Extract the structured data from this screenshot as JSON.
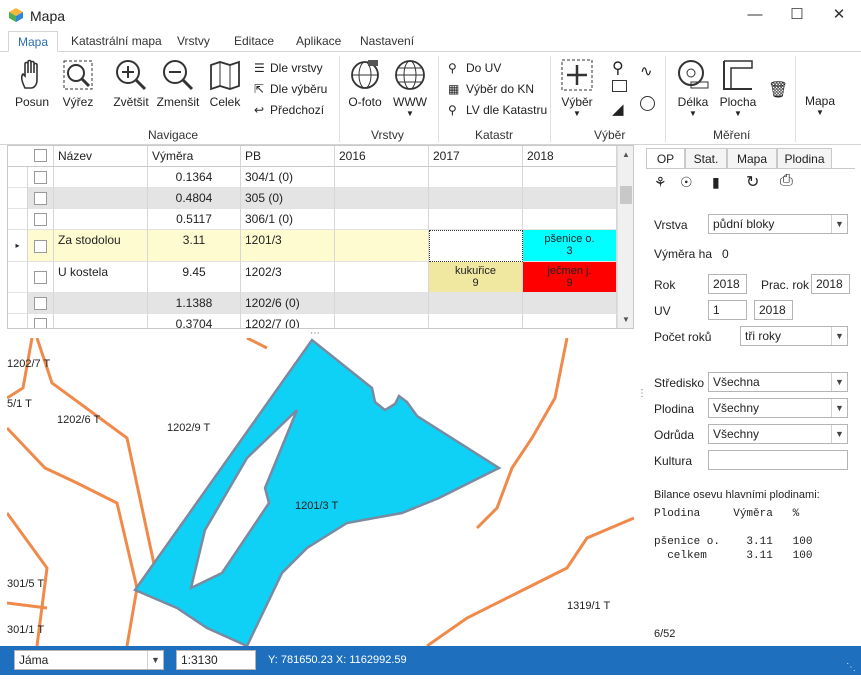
{
  "app": {
    "title": "Mapa"
  },
  "tabs": [
    "Mapa",
    "Katastrální mapa",
    "Vrstvy",
    "Editace",
    "Aplikace",
    "Nastavení"
  ],
  "ribbon": {
    "posun": "Posun",
    "vyrez": "Výřez",
    "zvetsit": "Zvětšit",
    "zmensit": "Zmenšit",
    "celek": "Celek",
    "dle_vrstvy": "Dle vrstvy",
    "dle_vyberu": "Dle výběru",
    "predchozi": "Předchozí",
    "ofoto": "O-foto",
    "www": "WWW",
    "do_uv": "Do UV",
    "vyber_kn": "Výběr do KN",
    "lv_katastr": "LV dle Katastru",
    "vyber": "Výběr",
    "delka": "Délka",
    "plocha": "Plocha",
    "mapa": "Mapa",
    "groups": {
      "navigace": "Navigace",
      "vrstvy": "Vrstvy",
      "katastr": "Katastr",
      "vyber": "Výběr",
      "mereni": "Měření"
    }
  },
  "grid": {
    "headers": [
      "Název",
      "Výměra",
      "PB",
      "2016",
      "2017",
      "2018"
    ],
    "rows": [
      {
        "name": "",
        "vymera": "0.1364",
        "pb": "304/1 (0)",
        "y2016": "",
        "y2017": "",
        "y2018": ""
      },
      {
        "name": "",
        "vymera": "0.4804",
        "pb": "305 (0)",
        "y2016": "",
        "y2017": "",
        "y2018": ""
      },
      {
        "name": "",
        "vymera": "0.5117",
        "pb": "306/1 (0)",
        "y2016": "",
        "y2017": "",
        "y2018": ""
      },
      {
        "name": "Za stodolou",
        "vymera": "3.11",
        "pb": "1201/3",
        "y2016": "",
        "y2017": "",
        "y2018": "pšenice o.\n3"
      },
      {
        "name": "U kostela",
        "vymera": "9.45",
        "pb": "1202/3",
        "y2016": "",
        "y2017": "kukuřice\n9",
        "y2018": "ječmen j.\n9"
      },
      {
        "name": "",
        "vymera": "1.1388",
        "pb": "1202/6 (0)",
        "y2016": "",
        "y2017": "",
        "y2018": ""
      },
      {
        "name": "",
        "vymera": "0.3704",
        "pb": "1202/7 (0)",
        "y2016": "",
        "y2017": "",
        "y2018": ""
      }
    ]
  },
  "map": {
    "labels": {
      "l1": "1202/7 T",
      "l2": "5/1 T",
      "l3": "1202/6 T",
      "l4": "1202/9 T",
      "l5": "1201/3 T",
      "l6": "301/5 T",
      "l7": "301/1 T",
      "l8": "1319/1 T"
    }
  },
  "side": {
    "tabs": [
      "OP",
      "Stat.",
      "Mapa",
      "Plodina"
    ],
    "vrstva_label": "Vrstva",
    "vrstva_value": "půdní bloky",
    "vymera_label": "Výměra ha",
    "vymera_value": "0",
    "rok_label": "Rok",
    "rok_value": "2018",
    "prac_rok_label": "Prac. rok",
    "prac_rok_value": "2018",
    "uv_label": "UV",
    "uv_value1": "1",
    "uv_value2": "2018",
    "pocet_label": "Počet roků",
    "pocet_value": "tři roky",
    "stredisko_label": "Středisko",
    "stredisko_value": "Všechna",
    "plodina_label": "Plodina",
    "plodina_value": "Všechny",
    "odruda_label": "Odrůda",
    "odruda_value": "Všechny",
    "kultura_label": "Kultura",
    "kultura_value": "",
    "bilance_title": "Bilance osevu hlavními plodinami:",
    "bilance_header": "Plodina     Výměra   %",
    "bilance_row1": "pšenice o.    3.11   100",
    "bilance_row2": "  celkem      3.11   100",
    "count": "6/52"
  },
  "status": {
    "combo": "Jáma",
    "scale": "1:3130",
    "coords": "Y: 781650.23  X: 1162992.59"
  },
  "colors": {
    "accent": "#1f6fbf",
    "parcel": "#0fd0f5",
    "line": "#f08a4b",
    "cyan": "#00ffff",
    "red": "#ff0000",
    "yellow": "#f0e8a0"
  }
}
